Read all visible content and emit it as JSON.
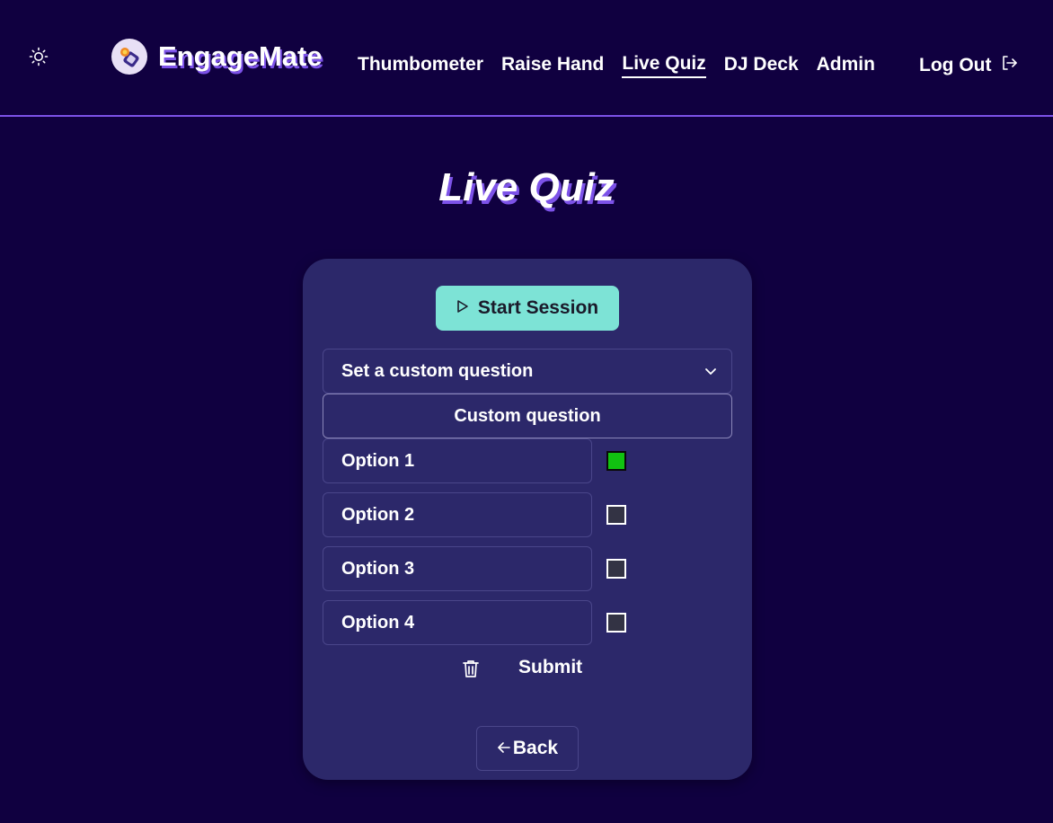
{
  "header": {
    "brand_name": "EngageMate",
    "theme_icon": "sun-icon",
    "logo_icon": "engagemate-logo-icon",
    "nav": [
      {
        "label": "Thumbometer",
        "active": false
      },
      {
        "label": "Raise Hand",
        "active": false
      },
      {
        "label": "Live Quiz",
        "active": true
      },
      {
        "label": "DJ Deck",
        "active": false
      },
      {
        "label": "Admin",
        "active": false
      }
    ],
    "logout_label": "Log Out",
    "logout_icon": "logout-icon"
  },
  "main": {
    "title": "Live Quiz",
    "start_label": "Start Session",
    "start_icon": "play-icon",
    "select_value": "Set a custom question",
    "select_icon": "chevron-down-icon",
    "question_placeholder": "Custom question",
    "options": [
      {
        "placeholder": "Option 1",
        "correct": true
      },
      {
        "placeholder": "Option 2",
        "correct": false
      },
      {
        "placeholder": "Option 3",
        "correct": false
      },
      {
        "placeholder": "Option 4",
        "correct": false
      }
    ],
    "delete_icon": "trash-icon",
    "submit_label": "Submit",
    "back_label": "Back",
    "back_icon": "arrow-left-icon"
  },
  "colors": {
    "background": "#100040",
    "card": "#2c286a",
    "accent": "#7c52e8",
    "start_button": "#7de3d6",
    "correct": "#11c211"
  }
}
